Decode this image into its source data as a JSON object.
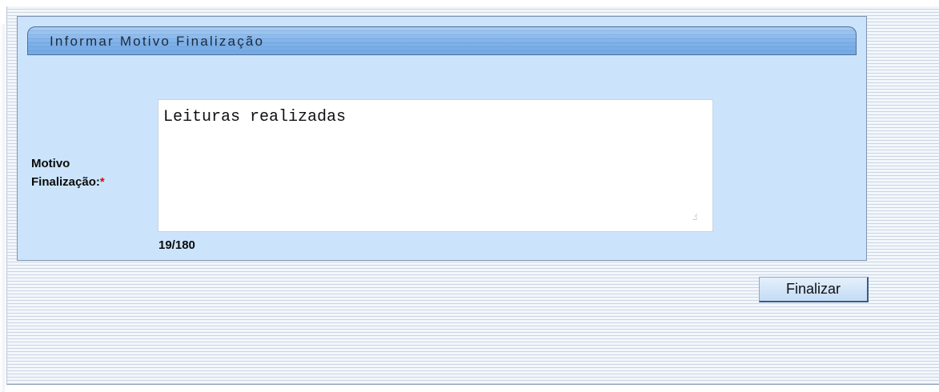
{
  "panel": {
    "title": "Informar Motivo Finalização"
  },
  "form": {
    "motivo_label_line1": "Motivo",
    "motivo_label_line2": "Finalização:",
    "required_mark": "*",
    "motivo_value": "Leituras realizadas",
    "char_counter": "19/180"
  },
  "actions": {
    "finalizar_label": "Finalizar"
  },
  "colors": {
    "panel_background": "#cce4fb",
    "header_gradient": "#7fb2ea",
    "required": "#d01010"
  }
}
